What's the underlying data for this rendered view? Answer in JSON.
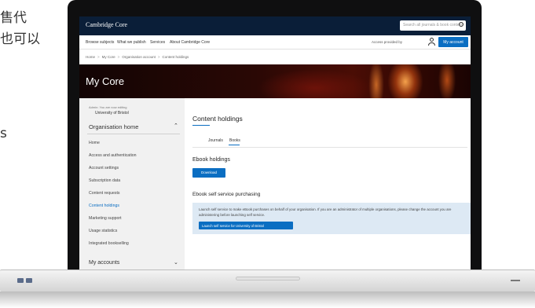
{
  "slide_text": {
    "line1": "售代",
    "line2": "也可以",
    "line3": "s"
  },
  "site": {
    "logo": "Cambridge Core",
    "search_placeholder": "Search all journals & book content",
    "nav": [
      "Browse subjects",
      "What we publish",
      "Services",
      "About Cambridge Core"
    ],
    "access_text": "Access provided by",
    "account_button": "My account"
  },
  "breadcrumb": [
    "Home",
    "My Core",
    "Organisation account",
    "Content holdings"
  ],
  "hero": {
    "title": "My Core"
  },
  "sidebar": {
    "org_label": "Admin: You are now editing",
    "org_name": "University of Bristol",
    "section_title": "Organisation home",
    "items": [
      "Home",
      "Access and authentication",
      "Account settings",
      "Subscription data",
      "Content requests",
      "Content holdings",
      "Marketing support",
      "Usage statistics",
      "Integrated bookselling"
    ],
    "active_index": 5,
    "my_accounts": "My accounts"
  },
  "content": {
    "title": "Content holdings",
    "tabs": [
      "Journals",
      "Books"
    ],
    "active_tab": "Books",
    "ebook_title": "Ebook holdings",
    "download_label": "Download",
    "self_service_title": "Ebook self service purchasing",
    "info_text": "Launch self service to make eBook purchases on behalf of your organisation. If you are an administrator of multiple organisations, please change the account you are administering before launching self service.",
    "launch_label": "Launch self service for University of Bristol"
  },
  "colors": {
    "accent": "#0b6ec2",
    "topbar": "#0a1e38",
    "info_bg": "#dde9f4"
  }
}
